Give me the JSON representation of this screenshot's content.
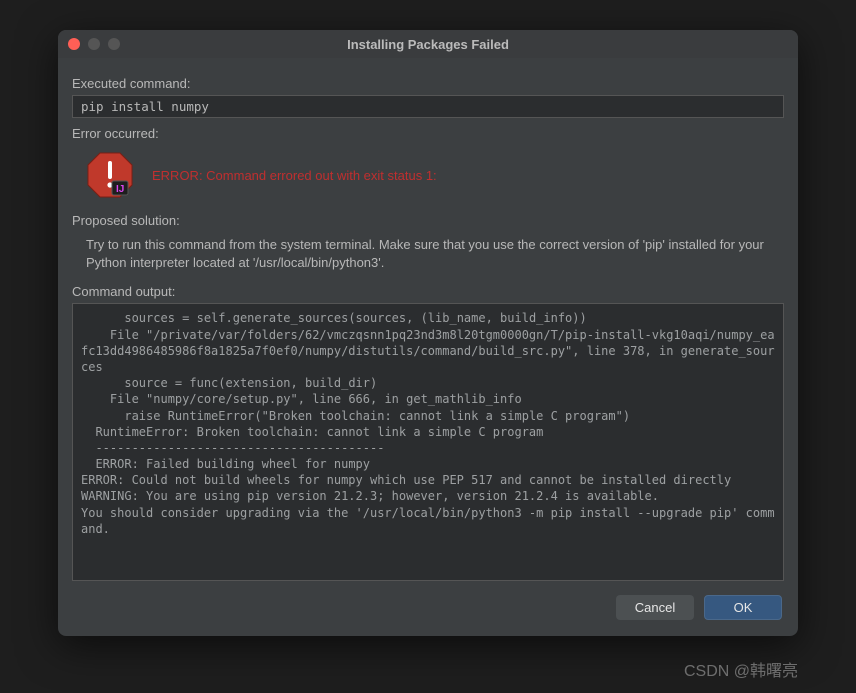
{
  "titlebar": {
    "title": "Installing Packages Failed"
  },
  "labels": {
    "executed": "Executed command:",
    "error_occurred": "Error occurred:",
    "proposed": "Proposed solution:",
    "output": "Command output:"
  },
  "command": "pip install numpy",
  "error_message": "ERROR: Command errored out with exit status 1:",
  "solution_text": "Try to run this command from the system terminal. Make sure that you use the correct version of 'pip' installed for your Python interpreter located at '/usr/local/bin/python3'.",
  "command_output": "      sources = self.generate_sources(sources, (lib_name, build_info))\n    File \"/private/var/folders/62/vmczqsnn1pq23nd3m8l20tgm0000gn/T/pip-install-vkg10aqi/numpy_eafc13dd4986485986f8a1825a7f0ef0/numpy/distutils/command/build_src.py\", line 378, in generate_sources\n      source = func(extension, build_dir)\n    File \"numpy/core/setup.py\", line 666, in get_mathlib_info\n      raise RuntimeError(\"Broken toolchain: cannot link a simple C program\")\n  RuntimeError: Broken toolchain: cannot link a simple C program\n  ----------------------------------------\n  ERROR: Failed building wheel for numpy\nERROR: Could not build wheels for numpy which use PEP 517 and cannot be installed directly\nWARNING: You are using pip version 21.2.3; however, version 21.2.4 is available.\nYou should consider upgrading via the '/usr/local/bin/python3 -m pip install --upgrade pip' command.\n",
  "buttons": {
    "cancel": "Cancel",
    "ok": "OK"
  },
  "watermark": "CSDN @韩曙亮"
}
